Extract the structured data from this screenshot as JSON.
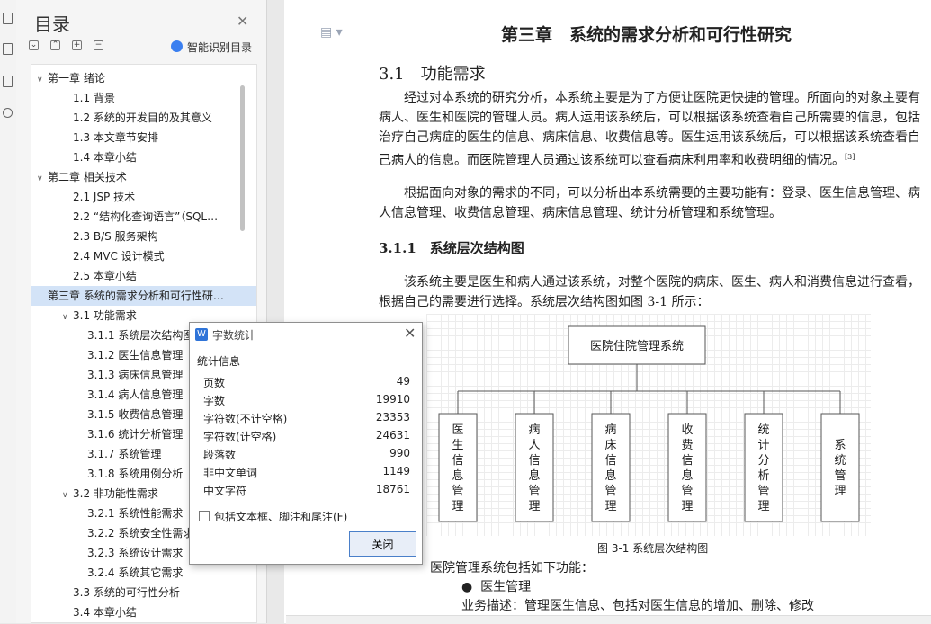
{
  "toc": {
    "title": "目录",
    "ai_label": "智能识别目录",
    "items": [
      {
        "text": "第一章  绪论",
        "level": 0,
        "chev": "∨"
      },
      {
        "text": "1.1  背景",
        "level": 1
      },
      {
        "text": "1.2  系统的开发目的及其意义",
        "level": 1
      },
      {
        "text": "1.3  本文章节安排",
        "level": 1
      },
      {
        "text": "1.4  本章小结",
        "level": 1
      },
      {
        "text": "第二章  相关技术",
        "level": 0,
        "chev": "∨"
      },
      {
        "text": "2.1  JSP 技术",
        "level": 1
      },
      {
        "text": "2.2  “结构化查询语言”（SQL…",
        "level": 1
      },
      {
        "text": "2.3  B/S 服务架构",
        "level": 1
      },
      {
        "text": "2.4  MVC 设计模式",
        "level": 1
      },
      {
        "text": "2.5  本章小结",
        "level": 1
      },
      {
        "text": "第三章  系统的需求分析和可行性研…",
        "level": 0,
        "selected": true
      },
      {
        "text": "3.1  功能需求",
        "level": 1,
        "chev": "∨"
      },
      {
        "text": "3.1.1  系统层次结构图",
        "level": 2
      },
      {
        "text": "3.1.2  医生信息管理",
        "level": 2
      },
      {
        "text": "3.1.3  病床信息管理",
        "level": 2
      },
      {
        "text": "3.1.4  病人信息管理",
        "level": 2
      },
      {
        "text": "3.1.5  收费信息管理",
        "level": 2
      },
      {
        "text": "3.1.6  统计分析管理",
        "level": 2
      },
      {
        "text": "3.1.7  系统管理",
        "level": 2
      },
      {
        "text": "3.1.8  系统用例分析",
        "level": 2
      },
      {
        "text": "3.2  非功能性需求",
        "level": 1,
        "chev": "∨"
      },
      {
        "text": "3.2.1  系统性能需求",
        "level": 2
      },
      {
        "text": "3.2.2  系统安全性需求",
        "level": 2
      },
      {
        "text": "3.2.3  系统设计需求",
        "level": 2
      },
      {
        "text": "3.2.4  系统其它需求",
        "level": 2
      },
      {
        "text": "3.3  系统的可行性分析",
        "level": 1
      },
      {
        "text": "3.4  本章小结",
        "level": 1
      }
    ]
  },
  "doc": {
    "chapter_title": "第三章　系统的需求分析和可行性研究",
    "section_title": "3.1　功能需求",
    "para1": "经过对本系统的研究分析，本系统主要是为了方便让医院更快捷的管理。所面向的对象主要有病人、医生和医院的管理人员。病人运用该系统后，可以根据该系统查看自己所需要的信息，包括治疗自己病症的医生的信息、病床信息、收费信息等。医生运用该系统后，可以根据该系统查看自己病人的信息。而医院管理人员通过该系统可以查看病床利用率和收费明细的情况。",
    "cite": "[3]",
    "para2": "根据面向对象的需求的不同，可以分析出本系统需要的主要功能有：登录、医生信息管理、病人信息管理、收费信息管理、病床信息管理、统计分析管理和系统管理。",
    "subsection_title": "3.1.1　系统层次结构图",
    "para3": "该系统主要是医生和病人通过该系统，对整个医院的病床、医生、病人和消费信息进行查看，根据自己的需要进行选择。系统层次结构图如图 3-1 所示：",
    "diagram": {
      "root": "医院住院管理系统",
      "children": [
        "医生信息管理",
        "病人信息管理",
        "病床信息管理",
        "收费信息管理",
        "统计分析管理",
        "系统管理"
      ]
    },
    "figure_caption": "图 3-1  系统层次结构图",
    "functions_intro": "医院管理系统包括如下功能：",
    "bullet1": "医生管理",
    "business_desc": "业务描述：管理医生信息、包括对医生信息的增加、删除、修改"
  },
  "dialog": {
    "title": "字数统计",
    "section_label": "统计信息",
    "stats": [
      {
        "label": "页数",
        "value": "49"
      },
      {
        "label": "字数",
        "value": "19910"
      },
      {
        "label": "字符数(不计空格)",
        "value": "23353"
      },
      {
        "label": "字符数(计空格)",
        "value": "24631"
      },
      {
        "label": "段落数",
        "value": "990"
      },
      {
        "label": "非中文单词",
        "value": "1149"
      },
      {
        "label": "中文字符",
        "value": "18761"
      }
    ],
    "checkbox_label": "包括文本框、脚注和尾注(F)",
    "close_label": "关闭"
  }
}
